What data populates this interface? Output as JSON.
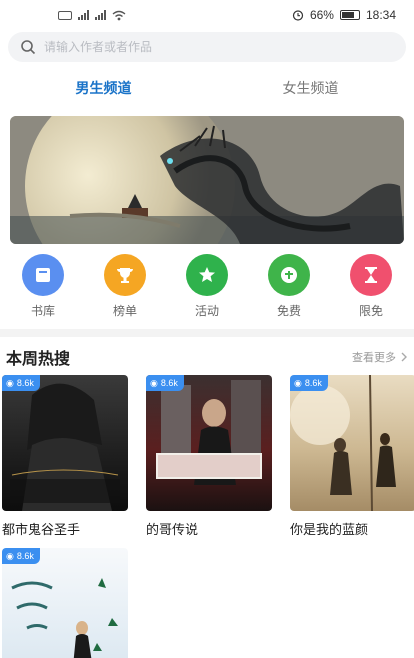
{
  "status_bar": {
    "battery": "66%",
    "time": "18:34"
  },
  "search": {
    "placeholder": "请输入作者或者作品"
  },
  "tabs": [
    {
      "label": "男生频道",
      "active": true
    },
    {
      "label": "女生频道",
      "active": false
    }
  ],
  "categories": [
    {
      "label": "书库",
      "icon": "library-icon",
      "color": "#5a8ff0"
    },
    {
      "label": "榜单",
      "icon": "trophy-icon",
      "color": "#f5a623"
    },
    {
      "label": "活动",
      "icon": "star-icon",
      "color": "#2fb24c"
    },
    {
      "label": "免费",
      "icon": "free-icon",
      "color": "#3fb44a"
    },
    {
      "label": "限免",
      "icon": "hourglass-icon",
      "color": "#f0506e"
    }
  ],
  "section": {
    "title": "本周热搜",
    "more": "查看更多"
  },
  "books": [
    {
      "title": "都市鬼谷圣手",
      "views": "8.6k"
    },
    {
      "title": "的哥传说",
      "views": "8.6k"
    },
    {
      "title": "你是我的蓝颜",
      "views": "8.6k"
    },
    {
      "title": "",
      "views": "8.6k"
    }
  ],
  "colors": {
    "accent": "#1a73c8",
    "badge": "#3b8ff0"
  }
}
